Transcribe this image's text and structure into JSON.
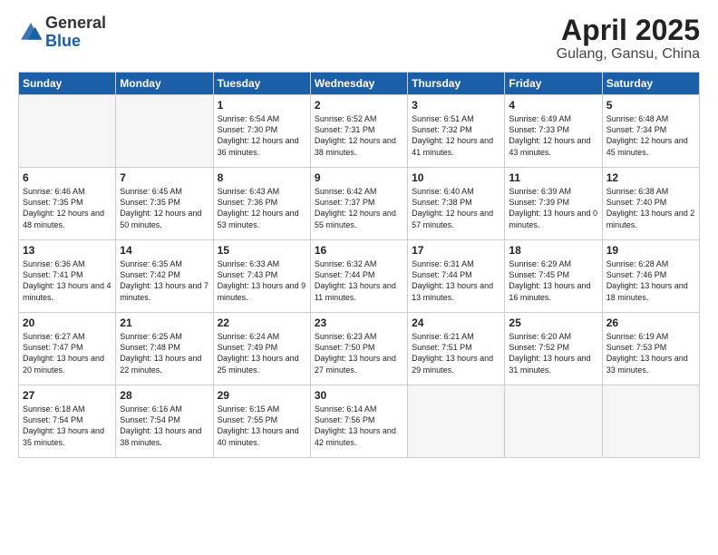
{
  "header": {
    "logo_general": "General",
    "logo_blue": "Blue",
    "title": "April 2025",
    "subtitle": "Gulang, Gansu, China"
  },
  "days_of_week": [
    "Sunday",
    "Monday",
    "Tuesday",
    "Wednesday",
    "Thursday",
    "Friday",
    "Saturday"
  ],
  "weeks": [
    {
      "days": [
        {
          "num": "",
          "empty": true
        },
        {
          "num": "",
          "empty": true
        },
        {
          "num": "1",
          "sunrise": "6:54 AM",
          "sunset": "7:30 PM",
          "daylight": "12 hours and 36 minutes."
        },
        {
          "num": "2",
          "sunrise": "6:52 AM",
          "sunset": "7:31 PM",
          "daylight": "12 hours and 38 minutes."
        },
        {
          "num": "3",
          "sunrise": "6:51 AM",
          "sunset": "7:32 PM",
          "daylight": "12 hours and 41 minutes."
        },
        {
          "num": "4",
          "sunrise": "6:49 AM",
          "sunset": "7:33 PM",
          "daylight": "12 hours and 43 minutes."
        },
        {
          "num": "5",
          "sunrise": "6:48 AM",
          "sunset": "7:34 PM",
          "daylight": "12 hours and 45 minutes."
        }
      ]
    },
    {
      "days": [
        {
          "num": "6",
          "sunrise": "6:46 AM",
          "sunset": "7:35 PM",
          "daylight": "12 hours and 48 minutes."
        },
        {
          "num": "7",
          "sunrise": "6:45 AM",
          "sunset": "7:35 PM",
          "daylight": "12 hours and 50 minutes."
        },
        {
          "num": "8",
          "sunrise": "6:43 AM",
          "sunset": "7:36 PM",
          "daylight": "12 hours and 53 minutes."
        },
        {
          "num": "9",
          "sunrise": "6:42 AM",
          "sunset": "7:37 PM",
          "daylight": "12 hours and 55 minutes."
        },
        {
          "num": "10",
          "sunrise": "6:40 AM",
          "sunset": "7:38 PM",
          "daylight": "12 hours and 57 minutes."
        },
        {
          "num": "11",
          "sunrise": "6:39 AM",
          "sunset": "7:39 PM",
          "daylight": "13 hours and 0 minutes."
        },
        {
          "num": "12",
          "sunrise": "6:38 AM",
          "sunset": "7:40 PM",
          "daylight": "13 hours and 2 minutes."
        }
      ]
    },
    {
      "days": [
        {
          "num": "13",
          "sunrise": "6:36 AM",
          "sunset": "7:41 PM",
          "daylight": "13 hours and 4 minutes."
        },
        {
          "num": "14",
          "sunrise": "6:35 AM",
          "sunset": "7:42 PM",
          "daylight": "13 hours and 7 minutes."
        },
        {
          "num": "15",
          "sunrise": "6:33 AM",
          "sunset": "7:43 PM",
          "daylight": "13 hours and 9 minutes."
        },
        {
          "num": "16",
          "sunrise": "6:32 AM",
          "sunset": "7:44 PM",
          "daylight": "13 hours and 11 minutes."
        },
        {
          "num": "17",
          "sunrise": "6:31 AM",
          "sunset": "7:44 PM",
          "daylight": "13 hours and 13 minutes."
        },
        {
          "num": "18",
          "sunrise": "6:29 AM",
          "sunset": "7:45 PM",
          "daylight": "13 hours and 16 minutes."
        },
        {
          "num": "19",
          "sunrise": "6:28 AM",
          "sunset": "7:46 PM",
          "daylight": "13 hours and 18 minutes."
        }
      ]
    },
    {
      "days": [
        {
          "num": "20",
          "sunrise": "6:27 AM",
          "sunset": "7:47 PM",
          "daylight": "13 hours and 20 minutes."
        },
        {
          "num": "21",
          "sunrise": "6:25 AM",
          "sunset": "7:48 PM",
          "daylight": "13 hours and 22 minutes."
        },
        {
          "num": "22",
          "sunrise": "6:24 AM",
          "sunset": "7:49 PM",
          "daylight": "13 hours and 25 minutes."
        },
        {
          "num": "23",
          "sunrise": "6:23 AM",
          "sunset": "7:50 PM",
          "daylight": "13 hours and 27 minutes."
        },
        {
          "num": "24",
          "sunrise": "6:21 AM",
          "sunset": "7:51 PM",
          "daylight": "13 hours and 29 minutes."
        },
        {
          "num": "25",
          "sunrise": "6:20 AM",
          "sunset": "7:52 PM",
          "daylight": "13 hours and 31 minutes."
        },
        {
          "num": "26",
          "sunrise": "6:19 AM",
          "sunset": "7:53 PM",
          "daylight": "13 hours and 33 minutes."
        }
      ]
    },
    {
      "days": [
        {
          "num": "27",
          "sunrise": "6:18 AM",
          "sunset": "7:54 PM",
          "daylight": "13 hours and 35 minutes."
        },
        {
          "num": "28",
          "sunrise": "6:16 AM",
          "sunset": "7:54 PM",
          "daylight": "13 hours and 38 minutes."
        },
        {
          "num": "29",
          "sunrise": "6:15 AM",
          "sunset": "7:55 PM",
          "daylight": "13 hours and 40 minutes."
        },
        {
          "num": "30",
          "sunrise": "6:14 AM",
          "sunset": "7:56 PM",
          "daylight": "13 hours and 42 minutes."
        },
        {
          "num": "",
          "empty": true
        },
        {
          "num": "",
          "empty": true
        },
        {
          "num": "",
          "empty": true
        }
      ]
    }
  ],
  "labels": {
    "sunrise": "Sunrise:",
    "sunset": "Sunset:",
    "daylight": "Daylight:"
  }
}
